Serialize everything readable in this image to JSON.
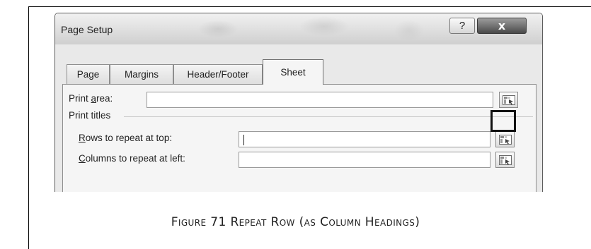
{
  "dialog": {
    "title": "Page Setup",
    "help_label": "?",
    "close_label": "x"
  },
  "tabs": [
    {
      "label": "Page",
      "active": false
    },
    {
      "label": "Margins",
      "active": false
    },
    {
      "label": "Header/Footer",
      "active": false
    },
    {
      "label": "Sheet",
      "active": true
    }
  ],
  "sheet": {
    "print_area": {
      "label_before": "Print ",
      "label_accel": "a",
      "label_after": "rea:",
      "value": ""
    },
    "print_titles_label": "Print titles",
    "rows_repeat": {
      "label_accel": "R",
      "label_after": "ows to repeat at top:",
      "value": ""
    },
    "cols_repeat": {
      "label_accel": "C",
      "label_after": "olumns to repeat at left:",
      "value": ""
    },
    "collapse_icon": "range-select-icon"
  },
  "caption": "Figure 71 Repeat Row (as Column Headings)"
}
